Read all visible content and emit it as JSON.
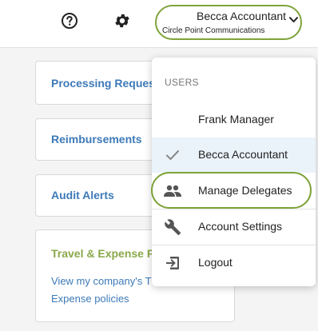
{
  "header": {
    "help_icon": "help-circle-icon",
    "settings_icon": "gear-icon",
    "user_name": "Becca Accountant",
    "company": "Circle Point Communications",
    "dropdown_icon": "chevron-down-icon"
  },
  "cards": {
    "processing": {
      "title": "Processing Request"
    },
    "reimbursements": {
      "title": "Reimbursements"
    },
    "audit": {
      "title": "Audit Alerts"
    },
    "travel": {
      "title": "Travel & Expense P",
      "links": [
        "View my company's T",
        "Expense policies"
      ]
    }
  },
  "user_menu": {
    "heading": "USERS",
    "users": [
      {
        "label": "Frank Manager",
        "selected": false
      },
      {
        "label": "Becca Accountant",
        "selected": true,
        "icon": "checkmark-icon"
      }
    ],
    "actions": [
      {
        "label": "Manage Delegates",
        "icon": "people-icon"
      },
      {
        "label": "Account Settings",
        "icon": "wrench-icon"
      },
      {
        "label": "Logout",
        "icon": "logout-icon"
      }
    ]
  },
  "colors": {
    "highlight": "#7ea33a",
    "link": "#3d7ab8",
    "travel_title": "#8aa84a",
    "selected_row": "#eaf3f9"
  }
}
